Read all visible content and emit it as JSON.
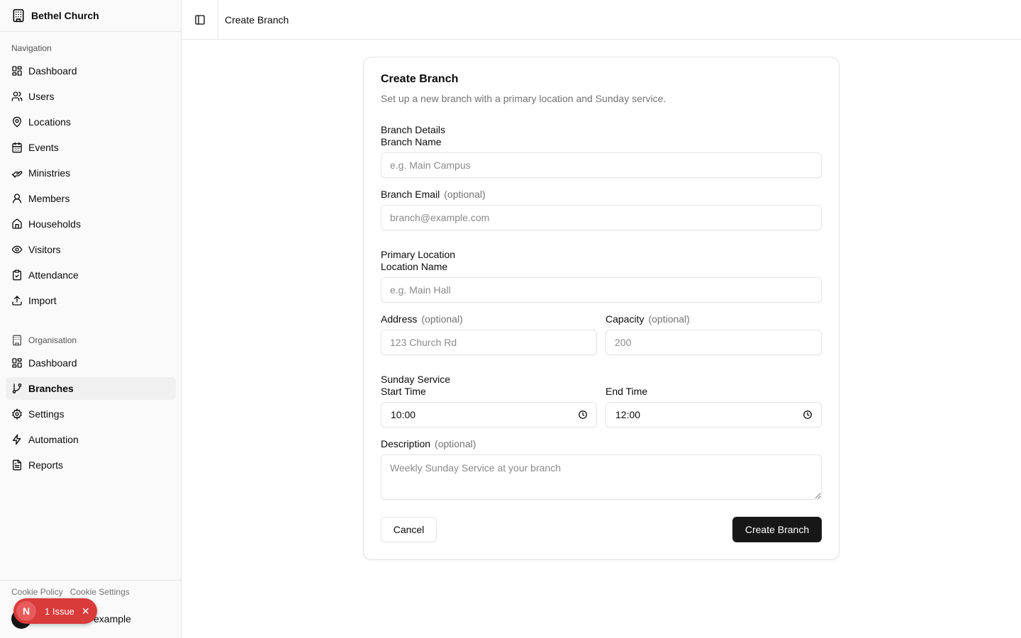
{
  "app": {
    "name": "Bethel Church"
  },
  "sidebar": {
    "navigation": {
      "label": "Navigation",
      "items": [
        {
          "label": "Dashboard",
          "icon": "dashboard-icon"
        },
        {
          "label": "Users",
          "icon": "users-icon"
        },
        {
          "label": "Locations",
          "icon": "map-pin-icon"
        },
        {
          "label": "Events",
          "icon": "calendar-icon"
        },
        {
          "label": "Ministries",
          "icon": "hand-heart-icon"
        },
        {
          "label": "Members",
          "icon": "user-icon"
        },
        {
          "label": "Households",
          "icon": "home-icon"
        },
        {
          "label": "Visitors",
          "icon": "eye-icon"
        },
        {
          "label": "Attendance",
          "icon": "clipboard-check-icon"
        },
        {
          "label": "Import",
          "icon": "upload-icon"
        }
      ]
    },
    "organisation": {
      "label": "Organisation",
      "items": [
        {
          "label": "Dashboard",
          "icon": "dashboard-icon"
        },
        {
          "label": "Branches",
          "icon": "git-branch-icon",
          "active": true
        },
        {
          "label": "Settings",
          "icon": "gear-icon"
        },
        {
          "label": "Automation",
          "icon": "zap-icon"
        },
        {
          "label": "Reports",
          "icon": "file-text-icon"
        }
      ]
    },
    "footer": {
      "cookie_policy": "Cookie Policy",
      "cookie_settings": "Cookie Settings",
      "user_email_visible": "example"
    }
  },
  "issue_badge": {
    "letter": "N",
    "text": "1 Issue",
    "close": "✕"
  },
  "header": {
    "title": "Create Branch"
  },
  "form": {
    "title": "Create Branch",
    "description": "Set up a new branch with a primary location and Sunday service.",
    "sections": {
      "branch_details": "Branch Details",
      "primary_location": "Primary Location",
      "sunday_service": "Sunday Service"
    },
    "optional_tag": "(optional)",
    "branch_name": {
      "label": "Branch Name",
      "placeholder": "e.g. Main Campus",
      "value": ""
    },
    "branch_email": {
      "label": "Branch Email",
      "placeholder": "branch@example.com",
      "value": ""
    },
    "location_name": {
      "label": "Location Name",
      "placeholder": "e.g. Main Hall",
      "value": ""
    },
    "address": {
      "label": "Address",
      "placeholder": "123 Church Rd",
      "value": ""
    },
    "capacity": {
      "label": "Capacity",
      "placeholder": "200",
      "value": ""
    },
    "start_time": {
      "label": "Start Time",
      "value": "10:00"
    },
    "end_time": {
      "label": "End Time",
      "value": "12:00"
    },
    "service_description": {
      "label": "Description",
      "placeholder": "Weekly Sunday Service at your branch",
      "value": ""
    },
    "cancel_label": "Cancel",
    "submit_label": "Create Branch"
  },
  "colors": {
    "primary_button": "#171717",
    "badge": "#d93a3a",
    "border": "#e5e5e5",
    "muted_text": "#737373"
  }
}
